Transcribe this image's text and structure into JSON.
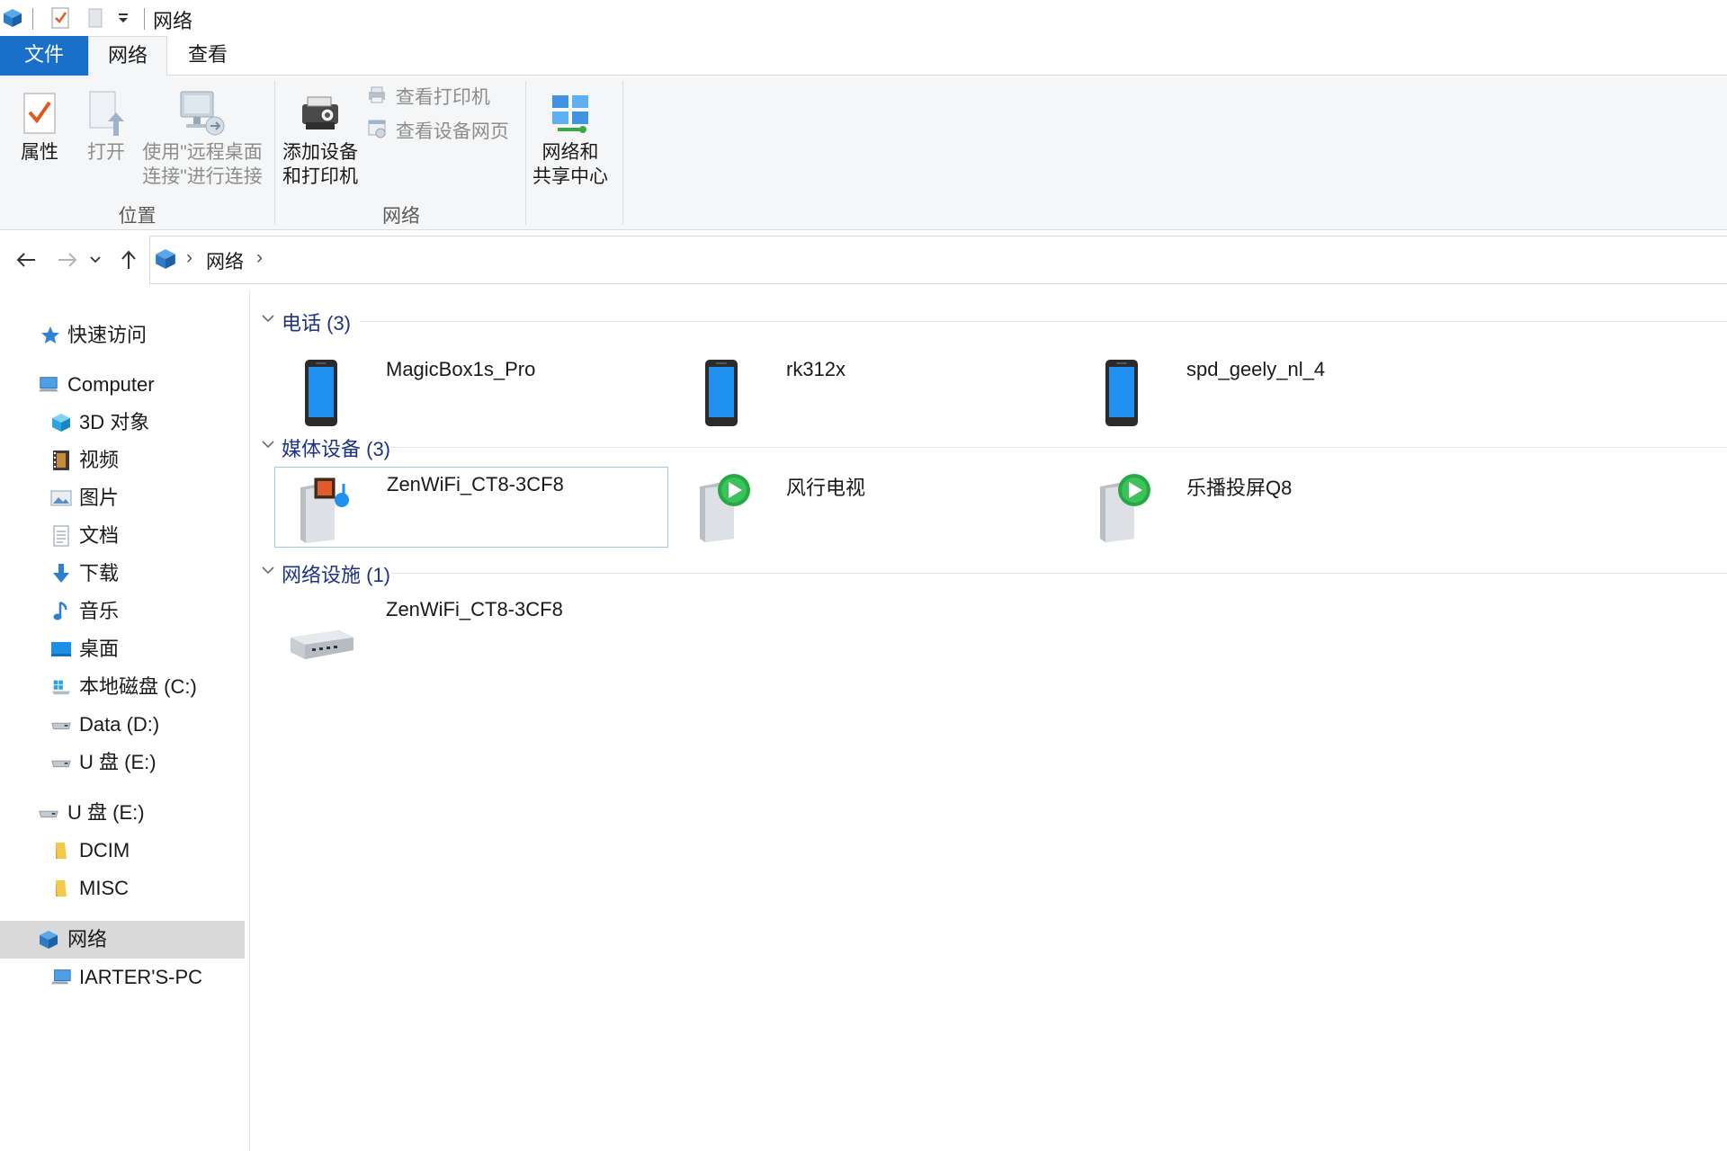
{
  "window": {
    "title": "网络",
    "quick_access_icons": [
      "network-icon",
      "properties-icon",
      "new-folder-icon",
      "customize-dropdown-icon"
    ]
  },
  "tabs": [
    {
      "label": "文件",
      "active": false
    },
    {
      "label": "网络",
      "active": true
    },
    {
      "label": "查看",
      "active": false
    }
  ],
  "ribbon": {
    "groups": [
      {
        "label": "位置",
        "buttons": [
          {
            "label_line1": "属性",
            "label_line2": "",
            "enabled": true,
            "icon": "properties-icon"
          },
          {
            "label_line1": "打开",
            "label_line2": "",
            "enabled": false,
            "icon": "open-icon"
          },
          {
            "label_line1": "使用\"远程桌面",
            "label_line2": "连接\"进行连接",
            "enabled": false,
            "icon": "remote-desktop-icon"
          }
        ]
      },
      {
        "label": "网络",
        "buttons": [
          {
            "label_line1": "添加设备",
            "label_line2": "和打印机",
            "enabled": true,
            "icon": "add-device-icon"
          }
        ],
        "small_buttons": [
          {
            "label": "查看打印机",
            "enabled": false,
            "icon": "printer-icon"
          },
          {
            "label": "查看设备网页",
            "enabled": false,
            "icon": "device-webpage-icon"
          }
        ]
      },
      {
        "label": "",
        "buttons": [
          {
            "label_line1": "网络和",
            "label_line2": "共享中心",
            "enabled": true,
            "icon": "network-sharing-center-icon"
          }
        ]
      }
    ]
  },
  "address": {
    "crumbs": [
      "网络"
    ]
  },
  "sidebar": {
    "items": [
      {
        "label": "快速访问",
        "icon": "star-icon",
        "indent": 0
      },
      {
        "label": "Computer",
        "icon": "computer-icon",
        "indent": 0
      },
      {
        "label": "3D 对象",
        "icon": "3d-objects-icon",
        "indent": 1
      },
      {
        "label": "视频",
        "icon": "video-icon",
        "indent": 1
      },
      {
        "label": "图片",
        "icon": "picture-icon",
        "indent": 1
      },
      {
        "label": "文档",
        "icon": "document-icon",
        "indent": 1
      },
      {
        "label": "下载",
        "icon": "download-icon",
        "indent": 1
      },
      {
        "label": "音乐",
        "icon": "music-icon",
        "indent": 1
      },
      {
        "label": "桌面",
        "icon": "desktop-icon",
        "indent": 1
      },
      {
        "label": "本地磁盘 (C:)",
        "icon": "windows-drive-icon",
        "indent": 1
      },
      {
        "label": "Data (D:)",
        "icon": "drive-icon",
        "indent": 1
      },
      {
        "label": "U 盘 (E:)",
        "icon": "usb-drive-icon",
        "indent": 1
      },
      {
        "label": "U 盘 (E:)",
        "icon": "usb-drive-icon",
        "indent": 0
      },
      {
        "label": "DCIM",
        "icon": "folder-icon",
        "indent": 1
      },
      {
        "label": "MISC",
        "icon": "folder-icon",
        "indent": 1
      },
      {
        "label": "网络",
        "icon": "network-icon",
        "indent": 0,
        "selected": true
      },
      {
        "label": "IARTER'S-PC",
        "icon": "pc-icon",
        "indent": 1
      }
    ]
  },
  "content": {
    "groups": [
      {
        "title": "电话 (3)",
        "items": [
          {
            "label": "MagicBox1s_Pro",
            "icon": "phone-icon"
          },
          {
            "label": "rk312x",
            "icon": "phone-icon"
          },
          {
            "label": "spd_geely_nl_4",
            "icon": "phone-icon"
          }
        ]
      },
      {
        "title": "媒体设备 (3)",
        "items": [
          {
            "label": "ZenWiFi_CT8-3CF8",
            "icon": "media-server-icon",
            "selected": true
          },
          {
            "label": "风行电视",
            "icon": "media-renderer-icon"
          },
          {
            "label": "乐播投屏Q8",
            "icon": "media-renderer-icon"
          }
        ]
      },
      {
        "title": "网络设施 (1)",
        "items": [
          {
            "label": "ZenWiFi_CT8-3CF8",
            "icon": "router-icon"
          }
        ]
      }
    ]
  },
  "colors": {
    "accent": "#1a6fc8",
    "group_title": "#1e3287",
    "selection_border": "#99c9ef",
    "sidebar_selected": "#d9d9d9",
    "ribbon_bg": "#f5f6f7"
  }
}
